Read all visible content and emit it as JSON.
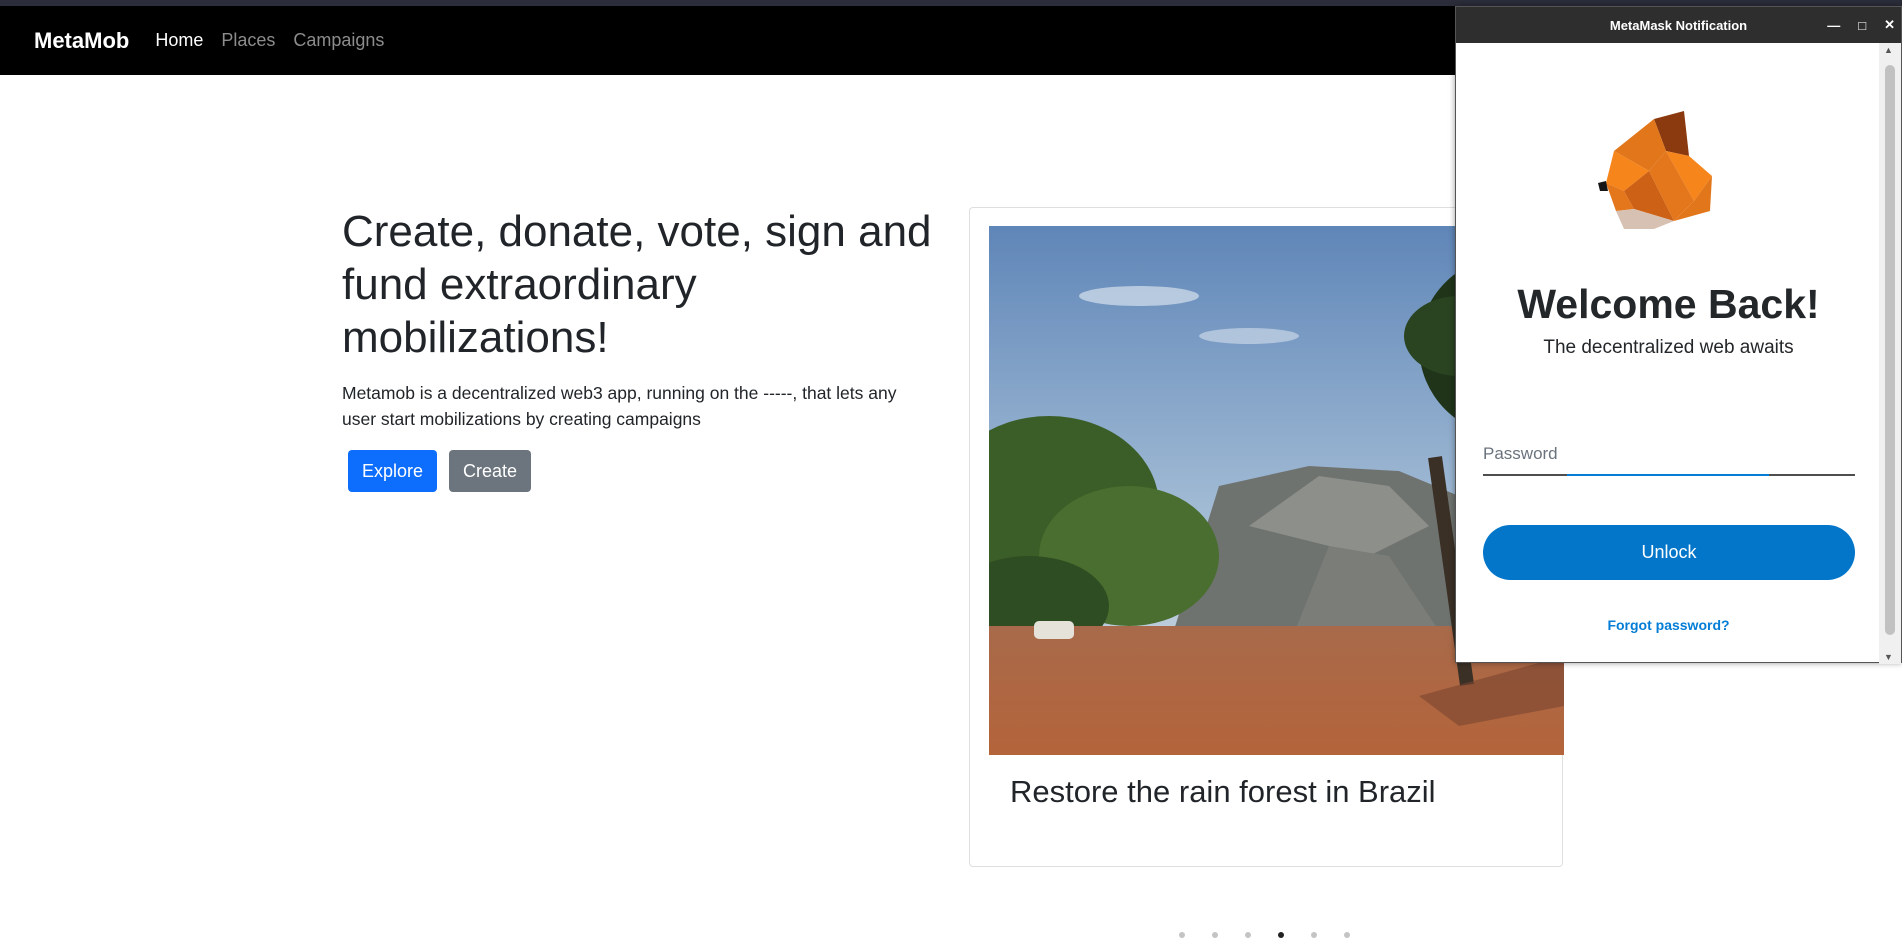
{
  "navbar": {
    "brand": "MetaMob",
    "links": [
      "Home",
      "Places",
      "Campaigns"
    ],
    "active": "Home"
  },
  "hero": {
    "heading": "Create, donate, vote, sign and fund extraordinary mobilizations!",
    "description": "Metamob is a decentralized web3 app, running on the -----, that lets any user start mobilizations by creating campaigns",
    "explore_label": "Explore",
    "create_label": "Create"
  },
  "carousel": {
    "card_title": "Restore the rain forest in Brazil",
    "slide_count": 6,
    "active_index": 3
  },
  "metamask": {
    "window_title": "MetaMask Notification",
    "welcome": "Welcome Back!",
    "tagline": "The decentralized web awaits",
    "password_label": "Password",
    "unlock_label": "Unlock",
    "forgot_label": "Forgot password?"
  },
  "colors": {
    "primary": "#0d6efd",
    "secondary": "#6c757d",
    "metamask_blue": "#0376c9"
  }
}
